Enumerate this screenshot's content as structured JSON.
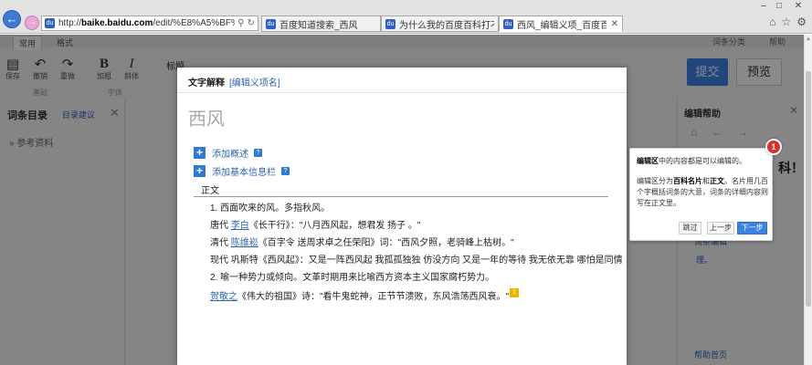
{
  "browser": {
    "window_controls": {
      "minimize": "–",
      "restore": "□",
      "close": "✕"
    },
    "address": {
      "prefix": "http://",
      "host": "baike.baidu.com",
      "path": "/edit/%E8%A5%BF%E9%A5",
      "icons": [
        "search-icon",
        "refresh-icon"
      ]
    },
    "tabs": [
      {
        "label": "百度知道搜索_西风",
        "active": false
      },
      {
        "label": "为什么我的百度百科打不开，...",
        "active": false
      },
      {
        "label": "西风_编辑义项_百度百科",
        "active": true
      }
    ],
    "tab_close": "✕",
    "icons": [
      "home-icon",
      "star-icon",
      "settings-icon"
    ]
  },
  "editor": {
    "mode_tabs": [
      "常用",
      "格式"
    ],
    "toolbar": {
      "tools": [
        {
          "icon": "save-icon",
          "glyph": "▤",
          "label": "保存"
        },
        {
          "icon": "undo-icon",
          "glyph": "↶",
          "label": "撤销"
        },
        {
          "icon": "redo-icon",
          "glyph": "↷",
          "label": "重做"
        },
        {
          "icon": "bold-icon",
          "glyph": "B",
          "label": "加粗"
        },
        {
          "icon": "italic-icon",
          "glyph": "I",
          "label": "斜体"
        }
      ],
      "group_labels": [
        "基础",
        "字体"
      ],
      "heading_labels": [
        "标题",
        "标题"
      ],
      "right_links": [
        "词条分类",
        "帮助"
      ],
      "submit": "提交",
      "preview": "预览"
    },
    "left_panel": {
      "title": "词条目录",
      "link": "目录建议",
      "close": "✕",
      "items": [
        "参考资料"
      ]
    },
    "help_panel": {
      "title": "编辑帮助",
      "close": "✕",
      "big_text": "科！",
      "links": [
        "»",
        "词条编辑",
        "理。"
      ],
      "home_link": "帮助首页"
    }
  },
  "modal": {
    "title": "文字解释",
    "title_link": "[编辑义项名]",
    "entry_title": "西风",
    "add_buttons": [
      {
        "label": "添加概述"
      },
      {
        "label": "添加基本信息栏"
      }
    ],
    "help_mark": "?",
    "section_title": "正文",
    "lines": [
      {
        "text": "1. 西面吹来的风。多指秋风。"
      },
      {
        "before": "唐代 ",
        "link": "李白",
        "after": "《长干行》：\"八月西风起，想君发 扬子 。\""
      },
      {
        "before": "清代 ",
        "link": "陈维崧",
        "after": "《百字令 送周求卓之任荣阳》词：\"西风夕照，老骑峰上枯树。\""
      },
      {
        "text": "现代 巩斯特《西风起》：又是一阵西风起 我孤孤独独 仿没方向 又是一年的等待 我无依无靠 哪怕是同情"
      },
      {
        "text": "2. 喻一种势力或倾向。文革时期用来比喻西方资本主义国家腐朽势力。"
      },
      {
        "before": "",
        "link": "贺敬之",
        "after": "《伟大的祖国》诗：\"看牛鬼蛇神，正节节溃败，东风浩荡西风衰。\"",
        "ref": "1"
      }
    ]
  },
  "tooltip": {
    "step": "1",
    "p1_bold": "编辑区",
    "p1": "中的内容都是可以编辑的。",
    "p2_a": "编辑区分为",
    "p2_bold1": "百科名片",
    "p2_b": "和",
    "p2_bold2": "正文",
    "p2_c": "。名片用几百个字概括词条的大意，词条的详细内容则写在正文里。",
    "skip": "跳过",
    "prev": "上一步",
    "next": "下一步"
  }
}
